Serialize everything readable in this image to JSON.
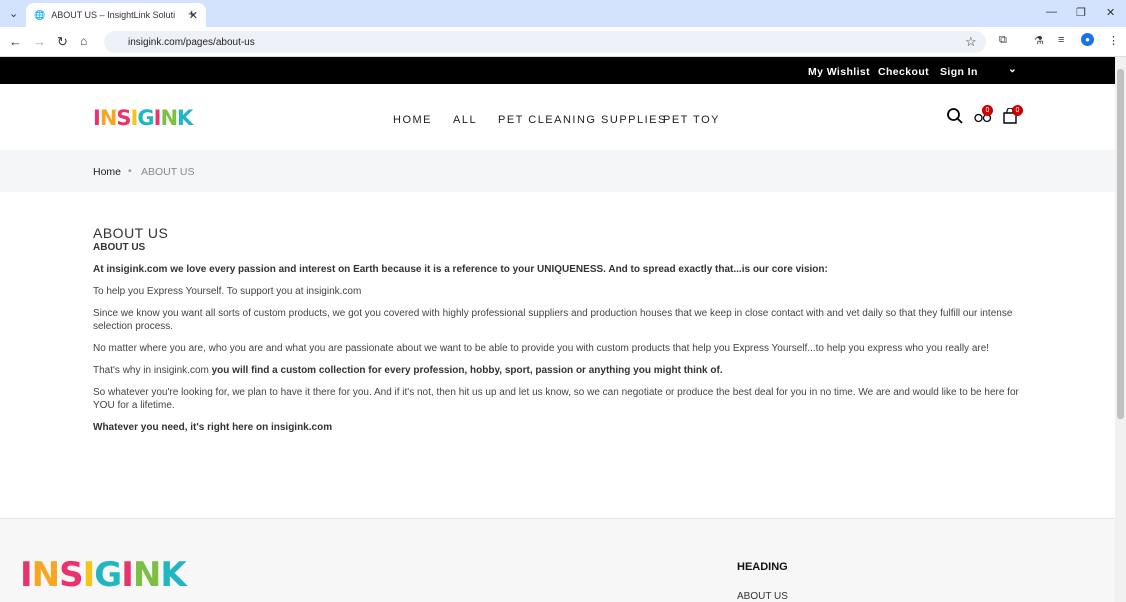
{
  "browser": {
    "tab_title": "ABOUT US – InsightLink Soluti",
    "url": "insigink.com/pages/about-us"
  },
  "topbar": {
    "wishlist": "My Wishlist",
    "checkout": "Checkout",
    "signin": "Sign In"
  },
  "header": {
    "logo": "INSIGINK",
    "nav": [
      "HOME",
      "ALL",
      "PET CLEANING SUPPLIES",
      "PET TOY"
    ],
    "compare_count": "0",
    "cart_count": "0"
  },
  "breadcrumb": {
    "home": "Home",
    "current": "ABOUT US"
  },
  "content": {
    "title": "ABOUT US",
    "subtitle": "ABOUT US",
    "p1": "At insigink.com we love every passion and interest on Earth because it is a reference to your UNIQUENESS. And to spread exactly that...is our core vision:",
    "p2": "To help you Express Yourself. To support you at insigink.com",
    "p3": "Since we know you want all sorts of custom products, we got you covered with highly professional suppliers and production houses that we keep in close contact with and vet daily so that they fulfill our intense selection process.",
    "p4": "No matter where you are, who you are and what you are passionate about we want to be able to provide you with custom products that help you Express Yourself...to help you express who you really are!",
    "p5a": "That's why in insigink.com ",
    "p5b": "you will find a custom collection for every profession, hobby, sport, passion or anything you might think of.",
    "p6": "So whatever you're looking for, we plan to have it there for you. And if it's not, then hit us up and let us know, so we can negotiate or produce the best deal for you in no time. We are and would like to be here for YOU for a lifetime.",
    "p7": "Whatever you need, it's right here on insigink.com"
  },
  "footer": {
    "logo": "INSIGINK",
    "heading": "HEADING",
    "link": "ABOUT US"
  }
}
